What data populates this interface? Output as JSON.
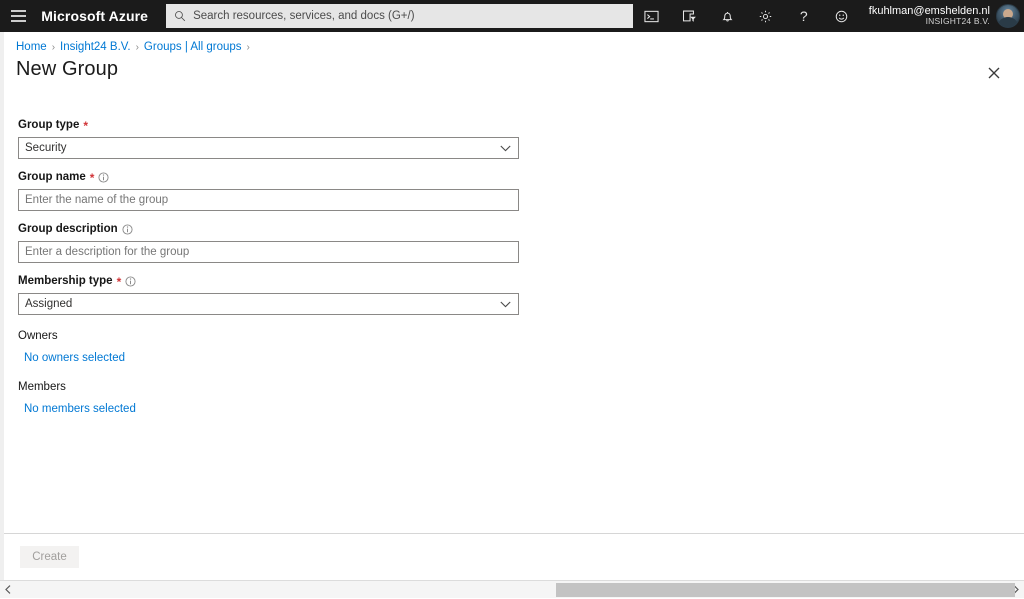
{
  "topbar": {
    "menu_label": "Show portal menu",
    "brand": "Microsoft Azure",
    "search": {
      "placeholder": "Search resources, services, and docs (G+/)",
      "value": ""
    },
    "icons": [
      {
        "name": "cloud-shell-icon",
        "title": "Cloud Shell"
      },
      {
        "name": "directories-subscriptions-icon",
        "title": "Directories + subscriptions"
      },
      {
        "name": "notifications-bell-icon",
        "title": "Notifications"
      },
      {
        "name": "settings-gear-icon",
        "title": "Settings"
      },
      {
        "name": "help-question-icon",
        "title": "Help"
      },
      {
        "name": "feedback-smiley-icon",
        "title": "Feedback"
      }
    ],
    "account": {
      "email": "fkuhlman@emshelden.nl",
      "org": "INSIGHT24 B.V."
    }
  },
  "breadcrumb": {
    "items": [
      {
        "label": "Home"
      },
      {
        "label": "Insight24 B.V."
      },
      {
        "label": "Groups | All groups"
      }
    ]
  },
  "page": {
    "title": "New Group",
    "close_label": "Close"
  },
  "form": {
    "group_type": {
      "label": "Group type",
      "required": true,
      "value": "Security"
    },
    "group_name": {
      "label": "Group name",
      "required": true,
      "placeholder": "Enter the name of the group",
      "value": ""
    },
    "group_description": {
      "label": "Group description",
      "required": false,
      "placeholder": "Enter a description for the group",
      "value": ""
    },
    "membership_type": {
      "label": "Membership type",
      "required": true,
      "value": "Assigned"
    },
    "owners": {
      "label": "Owners",
      "link": "No owners selected"
    },
    "members": {
      "label": "Members",
      "link": "No members selected"
    }
  },
  "footer": {
    "create_label": "Create",
    "create_disabled": true
  },
  "colors": {
    "topbar_bg": "#1b1b1b",
    "accent_link": "#0078d4",
    "required_asterisk": "#d13438",
    "field_border": "#8a8886",
    "disabled_button_bg": "#f3f2f1"
  }
}
